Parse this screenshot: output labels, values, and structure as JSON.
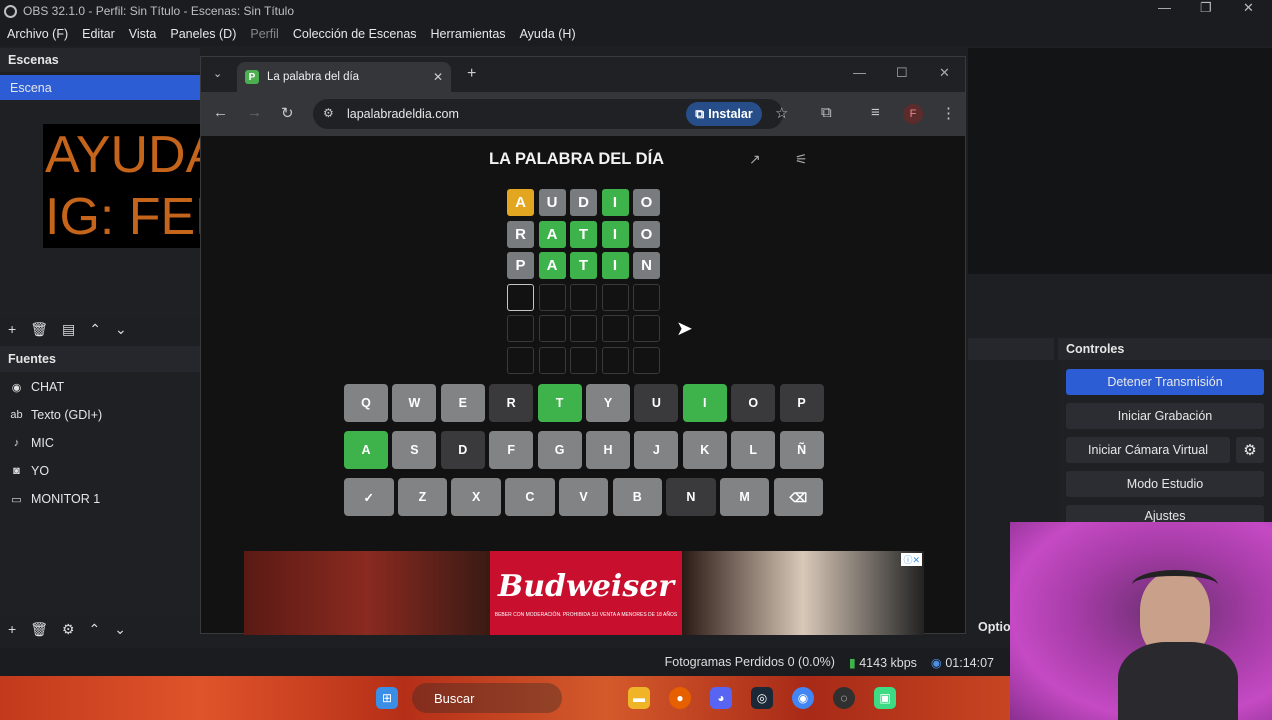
{
  "obs": {
    "title": "OBS 32.1.0 - Perfil: Sin Título - Escenas: Sin Título",
    "menu": [
      "Archivo (F)",
      "Editar",
      "Vista",
      "Paneles (D)",
      "Perfil",
      "Colección de Escenas",
      "Herramientas",
      "Ayuda (H)"
    ],
    "scenes": {
      "header": "Escenas",
      "items": [
        "Escena"
      ]
    },
    "sources": {
      "header": "Fuentes",
      "items": [
        {
          "label": "CHAT",
          "icon": "globe-icon"
        },
        {
          "label": "Texto (GDI+)",
          "icon": "text-icon"
        },
        {
          "label": "MIC",
          "icon": "mic-icon"
        },
        {
          "label": "YO",
          "icon": "camera-icon"
        },
        {
          "label": "MONITOR 1",
          "icon": "monitor-icon"
        }
      ]
    },
    "overlay": {
      "line1": "AYUDA CHAT :[",
      "line2": "IG: FERMA.OKR"
    },
    "controls": {
      "header": "Controles",
      "buttons": [
        "Detener Transmisión",
        "Iniciar Grabación",
        "Iniciar Cámara Virtual",
        "Modo Estudio",
        "Ajustes"
      ]
    },
    "partial_label": "Optio",
    "status": {
      "frames": "Fotogramas Perdidos 0 (0.0%)",
      "bitrate": "4143 kbps",
      "time": "01:14:07"
    }
  },
  "browser": {
    "tab_title": "La palabra del día",
    "favicon_letter": "P",
    "url": "lapalabradeldia.com",
    "install_label": "Instalar",
    "profile_initial": "F"
  },
  "game": {
    "title": "LA PALABRA DEL DÍA",
    "rows": [
      [
        [
          "A",
          "y"
        ],
        [
          "U",
          "x"
        ],
        [
          "D",
          "x"
        ],
        [
          "I",
          "g"
        ],
        [
          "O",
          "x"
        ]
      ],
      [
        [
          "R",
          "x"
        ],
        [
          "A",
          "g"
        ],
        [
          "T",
          "g"
        ],
        [
          "I",
          "g"
        ],
        [
          "O",
          "x"
        ]
      ],
      [
        [
          "P",
          "x"
        ],
        [
          "A",
          "g"
        ],
        [
          "T",
          "g"
        ],
        [
          "I",
          "g"
        ],
        [
          "N",
          "x"
        ]
      ],
      [
        [
          "",
          "c"
        ],
        [
          "",
          "e"
        ],
        [
          "",
          "e"
        ],
        [
          "",
          "e"
        ],
        [
          "",
          "e"
        ]
      ],
      [
        [
          "",
          "e"
        ],
        [
          "",
          "e"
        ],
        [
          "",
          "e"
        ],
        [
          "",
          "e"
        ],
        [
          "",
          "e"
        ]
      ],
      [
        [
          "",
          "e"
        ],
        [
          "",
          "e"
        ],
        [
          "",
          "e"
        ],
        [
          "",
          "e"
        ],
        [
          "",
          "e"
        ]
      ]
    ],
    "keyboard": [
      [
        [
          "Q",
          "n"
        ],
        [
          "W",
          "n"
        ],
        [
          "E",
          "n"
        ],
        [
          "R",
          "d"
        ],
        [
          "T",
          "g"
        ],
        [
          "Y",
          "n"
        ],
        [
          "U",
          "d"
        ],
        [
          "I",
          "g"
        ],
        [
          "O",
          "d"
        ],
        [
          "P",
          "d"
        ]
      ],
      [
        [
          "A",
          "g"
        ],
        [
          "S",
          "n"
        ],
        [
          "D",
          "d"
        ],
        [
          "F",
          "n"
        ],
        [
          "G",
          "n"
        ],
        [
          "H",
          "n"
        ],
        [
          "J",
          "n"
        ],
        [
          "K",
          "n"
        ],
        [
          "L",
          "n"
        ],
        [
          "Ñ",
          "n"
        ]
      ],
      [
        [
          "✓",
          "n"
        ],
        [
          "Z",
          "n"
        ],
        [
          "X",
          "n"
        ],
        [
          "C",
          "n"
        ],
        [
          "V",
          "n"
        ],
        [
          "B",
          "n"
        ],
        [
          "N",
          "d"
        ],
        [
          "M",
          "n"
        ],
        [
          "⌫",
          "n"
        ]
      ]
    ]
  },
  "ad": {
    "brand": "Budweiser",
    "disclaimer": "BEBER CON MODERACIÓN. PROHIBIDA SU VENTA A MENORES DE 18 AÑOS"
  },
  "taskbar": {
    "search": "Buscar"
  }
}
